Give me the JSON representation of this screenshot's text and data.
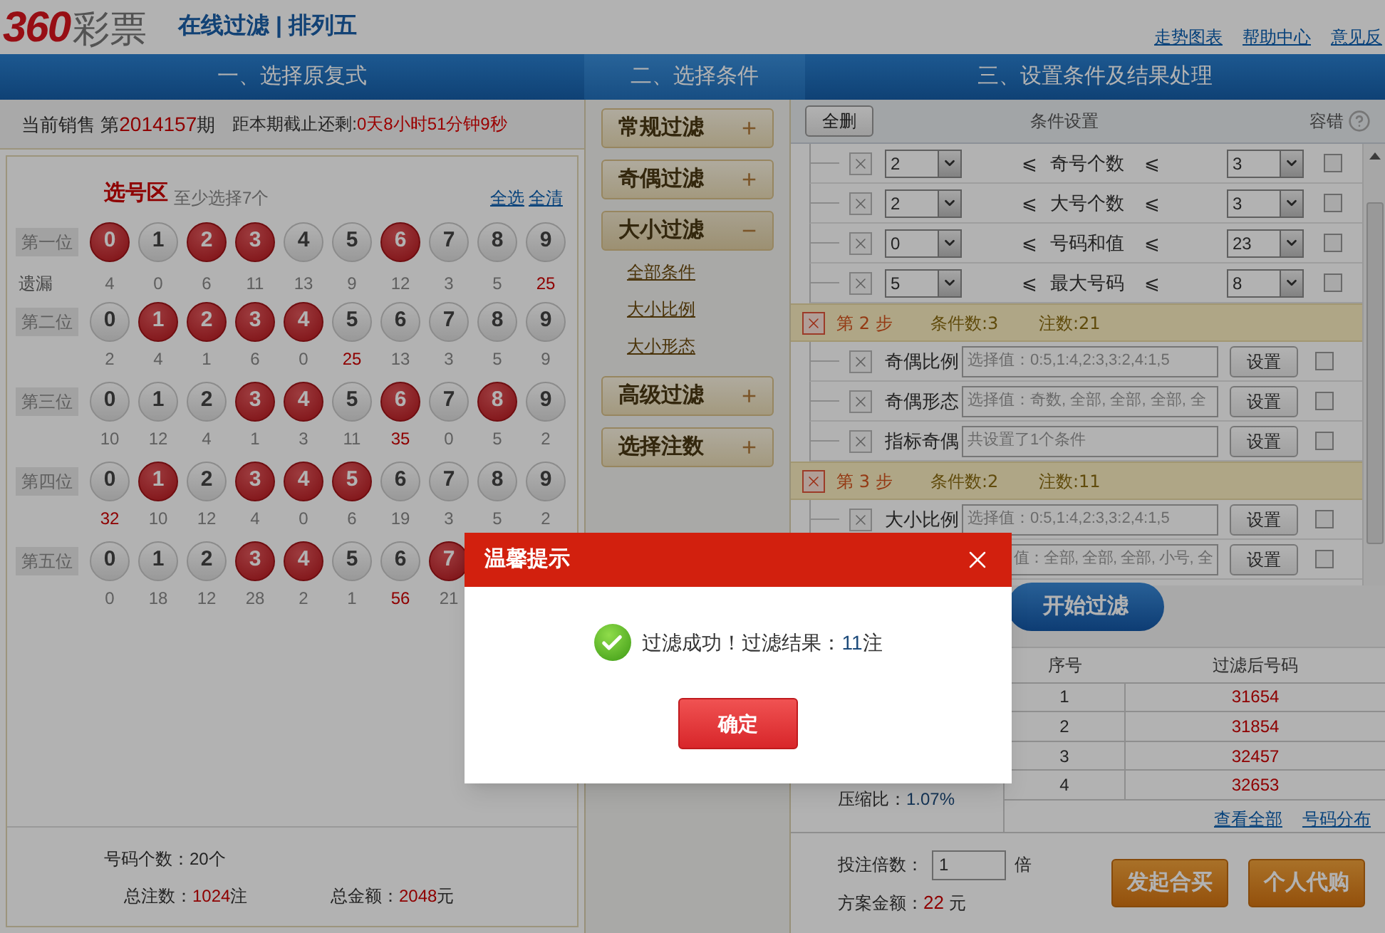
{
  "header": {
    "logo_number": "360",
    "logo_name": "彩票",
    "title": "在线过滤 | 排列五",
    "links": [
      "走势图表",
      "帮助中心",
      "意见反"
    ]
  },
  "steps": [
    "一、选择原复式",
    "二、选择条件",
    "三、设置条件及结果处理"
  ],
  "sale": {
    "label": "当前销售 第",
    "issue": "2014157",
    "suffix": "期",
    "countdown_label": "距本期截止还剩:",
    "countdown": "0天8小时51分钟9秒"
  },
  "picker": {
    "title": "选号区",
    "hint": "至少选择7个",
    "links": [
      "全选",
      "全清"
    ],
    "positions": [
      {
        "label": "第一位",
        "omission_label": "遗漏",
        "balls": [
          {
            "number": "0",
            "selected": true,
            "omission": "4",
            "hot": false
          },
          {
            "number": "1",
            "selected": false,
            "omission": "0",
            "hot": false
          },
          {
            "number": "2",
            "selected": true,
            "omission": "6",
            "hot": false
          },
          {
            "number": "3",
            "selected": true,
            "omission": "11",
            "hot": false
          },
          {
            "number": "4",
            "selected": false,
            "omission": "13",
            "hot": false
          },
          {
            "number": "5",
            "selected": false,
            "omission": "9",
            "hot": false
          },
          {
            "number": "6",
            "selected": true,
            "omission": "12",
            "hot": false
          },
          {
            "number": "7",
            "selected": false,
            "omission": "3",
            "hot": false
          },
          {
            "number": "8",
            "selected": false,
            "omission": "5",
            "hot": false
          },
          {
            "number": "9",
            "selected": false,
            "omission": "25",
            "hot": true
          }
        ]
      },
      {
        "label": "第二位",
        "balls": [
          {
            "number": "0",
            "selected": false,
            "omission": "2",
            "hot": false
          },
          {
            "number": "1",
            "selected": true,
            "omission": "4",
            "hot": false
          },
          {
            "number": "2",
            "selected": true,
            "omission": "1",
            "hot": false
          },
          {
            "number": "3",
            "selected": true,
            "omission": "6",
            "hot": false
          },
          {
            "number": "4",
            "selected": true,
            "omission": "0",
            "hot": false
          },
          {
            "number": "5",
            "selected": false,
            "omission": "25",
            "hot": true
          },
          {
            "number": "6",
            "selected": false,
            "omission": "13",
            "hot": false
          },
          {
            "number": "7",
            "selected": false,
            "omission": "3",
            "hot": false
          },
          {
            "number": "8",
            "selected": false,
            "omission": "5",
            "hot": false
          },
          {
            "number": "9",
            "selected": false,
            "omission": "9",
            "hot": false
          }
        ]
      },
      {
        "label": "第三位",
        "balls": [
          {
            "number": "0",
            "selected": false,
            "omission": "10",
            "hot": false
          },
          {
            "number": "1",
            "selected": false,
            "omission": "12",
            "hot": false
          },
          {
            "number": "2",
            "selected": false,
            "omission": "4",
            "hot": false
          },
          {
            "number": "3",
            "selected": true,
            "omission": "1",
            "hot": false
          },
          {
            "number": "4",
            "selected": true,
            "omission": "3",
            "hot": false
          },
          {
            "number": "5",
            "selected": false,
            "omission": "11",
            "hot": false
          },
          {
            "number": "6",
            "selected": true,
            "omission": "35",
            "hot": true
          },
          {
            "number": "7",
            "selected": false,
            "omission": "0",
            "hot": false
          },
          {
            "number": "8",
            "selected": true,
            "omission": "5",
            "hot": false
          },
          {
            "number": "9",
            "selected": false,
            "omission": "2",
            "hot": false
          }
        ]
      },
      {
        "label": "第四位",
        "balls": [
          {
            "number": "0",
            "selected": false,
            "omission": "32",
            "hot": true
          },
          {
            "number": "1",
            "selected": true,
            "omission": "10",
            "hot": false
          },
          {
            "number": "2",
            "selected": false,
            "omission": "12",
            "hot": false
          },
          {
            "number": "3",
            "selected": true,
            "omission": "4",
            "hot": false
          },
          {
            "number": "4",
            "selected": true,
            "omission": "0",
            "hot": false
          },
          {
            "number": "5",
            "selected": true,
            "omission": "6",
            "hot": false
          },
          {
            "number": "6",
            "selected": false,
            "omission": "19",
            "hot": false
          },
          {
            "number": "7",
            "selected": false,
            "omission": "3",
            "hot": false
          },
          {
            "number": "8",
            "selected": false,
            "omission": "5",
            "hot": false
          },
          {
            "number": "9",
            "selected": false,
            "omission": "2",
            "hot": false
          }
        ]
      },
      {
        "label": "第五位",
        "balls": [
          {
            "number": "0",
            "selected": false,
            "omission": "0",
            "hot": false
          },
          {
            "number": "1",
            "selected": false,
            "omission": "18",
            "hot": false
          },
          {
            "number": "2",
            "selected": false,
            "omission": "12",
            "hot": false
          },
          {
            "number": "3",
            "selected": true,
            "omission": "28",
            "hot": false
          },
          {
            "number": "4",
            "selected": true,
            "omission": "2",
            "hot": false
          },
          {
            "number": "5",
            "selected": false,
            "omission": "1",
            "hot": false
          },
          {
            "number": "6",
            "selected": false,
            "omission": "56",
            "hot": true
          },
          {
            "number": "7",
            "selected": true,
            "omission": "21",
            "hot": false
          }
        ]
      }
    ]
  },
  "summary": {
    "count_label": "号码个数：",
    "count": "20个",
    "bets_label": "总注数：",
    "bets": "1024",
    "bets_unit": "注",
    "amount_label": "总金额：",
    "amount": "2048",
    "amount_unit": "元"
  },
  "filters": [
    {
      "label": "常规过滤",
      "expanded": false,
      "symbol": "+"
    },
    {
      "label": "奇偶过滤",
      "expanded": false,
      "symbol": "+"
    },
    {
      "label": "大小过滤",
      "expanded": true,
      "symbol": "−",
      "children": [
        "全部条件",
        "大小比例",
        "大小形态"
      ]
    },
    {
      "label": "高级过滤",
      "expanded": false,
      "symbol": "+"
    },
    {
      "label": "选择注数",
      "expanded": false,
      "symbol": "+"
    }
  ],
  "conditions": {
    "delete_all": "全删",
    "title": "条件设置",
    "tolerance": "容错",
    "items": [
      {
        "kind": "range",
        "min": "2",
        "op_left": "⩽",
        "label": "奇号个数",
        "op_right": "⩽",
        "max": "3",
        "checked": false
      },
      {
        "kind": "range",
        "min": "2",
        "op_left": "⩽",
        "label": "大号个数",
        "op_right": "⩽",
        "max": "3",
        "checked": false
      },
      {
        "kind": "range",
        "min": "0",
        "op_left": "⩽",
        "label": "号码和值",
        "op_right": "⩽",
        "max": "23",
        "checked": false
      },
      {
        "kind": "range",
        "min": "5",
        "op_left": "⩽",
        "label": "最大号码",
        "op_right": "⩽",
        "max": "8",
        "checked": false
      },
      {
        "kind": "step",
        "title": "第 2 步",
        "count": "条件数:3",
        "bets": "注数:21"
      },
      {
        "kind": "text",
        "label": "奇偶比例",
        "value": "选择值：0:5,1:4,2:3,3:2,4:1,5",
        "button": "设置",
        "checked": false
      },
      {
        "kind": "text",
        "label": "奇偶形态",
        "value": "选择值：奇数, 全部, 全部, 全部, 全",
        "button": "设置",
        "checked": false
      },
      {
        "kind": "text",
        "label": "指标奇偶",
        "value": "共设置了1个条件",
        "button": "设置",
        "checked": false
      },
      {
        "kind": "step",
        "title": "第 3 步",
        "count": "条件数:2",
        "bets": "注数:11"
      },
      {
        "kind": "text",
        "label": "大小比例",
        "value": "选择值：0:5,1:4,2:3,3:2,4:1,5",
        "button": "设置",
        "checked": false
      },
      {
        "kind": "text",
        "value": "值：全部, 全部, 全部, 小号, 全",
        "button": "设置",
        "checked": false
      }
    ]
  },
  "start_button": "开始过滤",
  "results": {
    "ratio_label": "压缩比：",
    "ratio": "1.07%",
    "columns": [
      "序号",
      "过滤后号码"
    ],
    "rows": [
      [
        "1",
        "31654"
      ],
      [
        "2",
        "31854"
      ],
      [
        "3",
        "32457"
      ],
      [
        "4",
        "32653"
      ]
    ],
    "links": [
      "查看全部",
      "号码分布"
    ]
  },
  "order": {
    "multiple_label": "投注倍数：",
    "multiple": "1",
    "multiple_unit": "倍",
    "amount_label": "方案金额：",
    "amount": "22",
    "amount_unit": "元",
    "buttons": [
      "发起合买",
      "个人代购"
    ]
  },
  "dialog": {
    "title": "温馨提示",
    "message": "过滤成功！过滤结果：",
    "result": "11",
    "result_unit": "注",
    "button": "确定"
  }
}
